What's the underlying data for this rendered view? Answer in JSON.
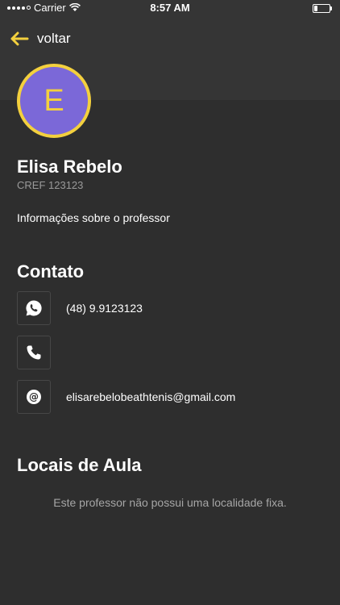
{
  "status_bar": {
    "carrier": "Carrier",
    "time": "8:57 AM",
    "battery_level": 0.2
  },
  "header": {
    "back_label": "voltar",
    "back_icon": "arrow-left-icon",
    "accent_color": "#f3d03e"
  },
  "profile": {
    "avatar_letter": "E",
    "avatar_color": "#7b68d8",
    "name": "Elisa Rebelo",
    "cref": "CREF 123123",
    "info": "Informações sobre o professor"
  },
  "contact": {
    "title": "Contato",
    "items": [
      {
        "icon": "whatsapp-icon",
        "text": "(48) 9.9123123"
      },
      {
        "icon": "phone-icon",
        "text": ""
      },
      {
        "icon": "at-icon",
        "text": "elisarebelobeathtenis@gmail.com"
      }
    ]
  },
  "locations": {
    "title": "Locais de Aula",
    "empty_message": "Este professor não possui uma localidade fixa."
  }
}
